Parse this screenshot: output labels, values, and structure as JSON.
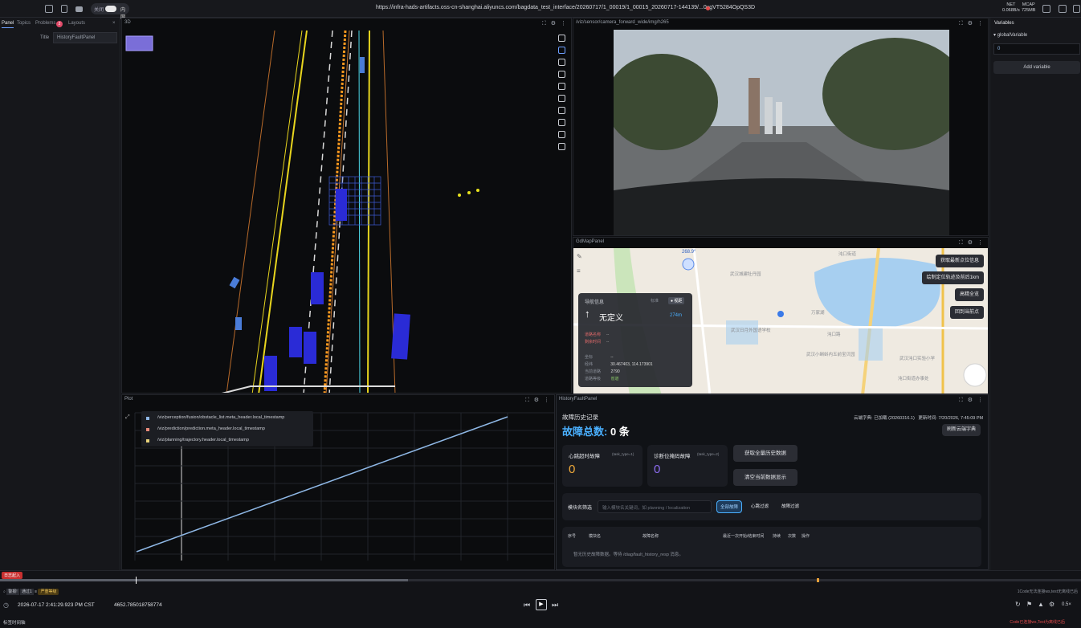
{
  "topbar": {
    "toggle_left": "关闭",
    "toggle_right": "内网",
    "url": "https://infra-hads-artifacts.oss-cn-shanghai.aliyuncs.com/bagdata_test_interface/20260717/1_00019/1_00015_20260717-144139/...0vgVT5284OpQS3D",
    "net_label": "NET",
    "net_value": "0.068B/s",
    "mcap_label": "MCAP",
    "mcap_value": "725MB"
  },
  "left": {
    "tabs": [
      "Panel",
      "Topics",
      "Problems",
      "Layouts"
    ],
    "problems_count": "2",
    "title_label": "Title",
    "title_value": "HistoryFaultPanel"
  },
  "p3d": {
    "title": "3D"
  },
  "camera": {
    "title": "/viz/sensor/camera_forward_wide/img/h265"
  },
  "map": {
    "title": "GdMapPanel",
    "heading": "268.9°",
    "buttons": [
      "获取最新点位信息",
      "绘制定位轨迹及前后1km",
      "高精全览",
      "回到当前点"
    ],
    "nav": {
      "header": "导航信息",
      "mode": "标准",
      "mode_extra": "● 视距",
      "direction": "无定义",
      "distance": "274m",
      "rows": [
        {
          "k": "道路名称",
          "v": "--"
        },
        {
          "k": "剩余时间",
          "v": "--"
        },
        {
          "k": "坐标",
          "v": "--"
        },
        {
          "k": "经纬",
          "v": "30.467403, 114.173901"
        },
        {
          "k": "当前道路",
          "v": "2790"
        },
        {
          "k": "道路等级",
          "v": "省道"
        }
      ]
    },
    "places": [
      "武汉城建牡丹园",
      "武汉日月外国语学校",
      "武汉小蝌蚪内五前宝贝园",
      "沌口街道",
      "沌口路",
      "武汉沌口实验小学",
      "沌口街道办事处",
      "万家湖"
    ]
  },
  "plot": {
    "title": "Plot",
    "series": [
      {
        "name": "/viz/perception/fusion/obstacle_list.meta_header.local_timestamp",
        "color": "#8fb8e6"
      },
      {
        "name": "/viz/prediction/prediction.meta_header.local_timestamp",
        "color": "#e88a7a"
      },
      {
        "name": "/viz/planning/trajectory.header.local_timestamp",
        "color": "#e8d27a"
      }
    ]
  },
  "history": {
    "title": "HistoryFaultPanel",
    "section": "故障历史记录",
    "total_label": "故障总数:",
    "total_value": "0 条",
    "cloud_label": "云端字典:",
    "cloud_value": "已加载 (20260316.1)",
    "update_label": "更新时间:",
    "update_value": "7/20/2026, 7:45:09 PM",
    "refresh_dict": "刷新云端字典",
    "card1_title": "心跳超时故障",
    "card1_type": "(task_type=1)",
    "card1_value": "0",
    "card2_title": "诊断位掩码故障",
    "card2_type": "(task_type=2)",
    "card2_value": "0",
    "btn_fetch": "获取全量历史数据",
    "btn_clear": "清空当前数据显示",
    "filter_label": "模块名筛选",
    "filter_placeholder": "输入模块名关键词，如 planning / localization",
    "filter_all": "全部故障",
    "filter_heartbeat": "心跳过滤",
    "filter_fault": "故障过滤",
    "columns": [
      "序号",
      "模块名",
      "故障名称",
      "最近一次开始/结束时间",
      "持续",
      "次数",
      "操作"
    ],
    "empty": "暂无历史故障数据。等待 /diag/fault_history_resp 消息。"
  },
  "vars": {
    "title": "Variables",
    "var_name": "globalVariable",
    "var_value": "0",
    "add": "Add variable"
  },
  "timeline": {
    "start_badge": "日志起入",
    "datetime": "2026-07-17 2:41:29.923 PM CST",
    "seconds": "4652.785018758774",
    "speed": "0.5×",
    "bottom_left": "标签时间轴",
    "bottom_right": "Code已连接ws,Test为离线已后",
    "filter1": "警报!",
    "filter2": "通过1",
    "tag": "严重等级",
    "hover_right": "1Code无法连接ws,test无离线已后"
  }
}
